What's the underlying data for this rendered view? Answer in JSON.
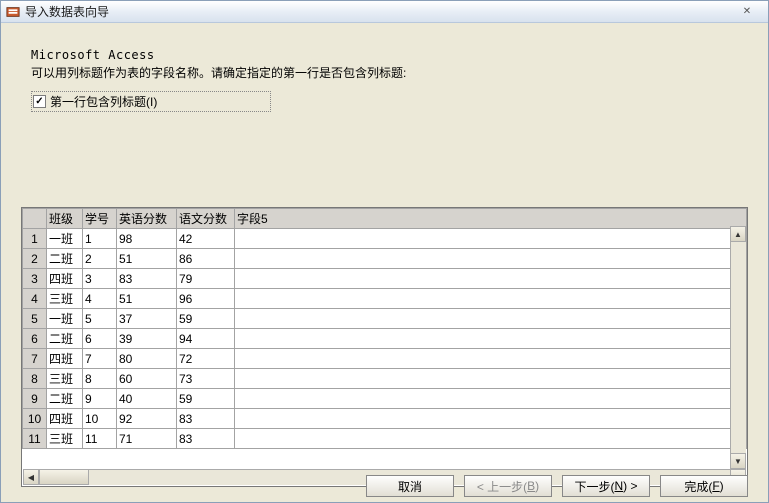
{
  "window": {
    "title": "导入数据表向导",
    "close_glyph": "✕"
  },
  "intro": {
    "app_name": "Microsoft Access",
    "instruction": "可以用列标题作为表的字段名称。请确定指定的第一行是否包含列标题:"
  },
  "checkbox": {
    "label": "第一行包含列标题(I)",
    "checked_glyph": "✓"
  },
  "grid": {
    "headers": [
      "班级",
      "学号",
      "英语分数",
      "语文分数",
      "字段5"
    ],
    "rows": [
      {
        "n": "1",
        "class": "一班",
        "sid": "1",
        "eng": "98",
        "chi": "42"
      },
      {
        "n": "2",
        "class": "二班",
        "sid": "2",
        "eng": "51",
        "chi": "86"
      },
      {
        "n": "3",
        "class": "四班",
        "sid": "3",
        "eng": "83",
        "chi": "79"
      },
      {
        "n": "4",
        "class": "三班",
        "sid": "4",
        "eng": "51",
        "chi": "96"
      },
      {
        "n": "5",
        "class": "一班",
        "sid": "5",
        "eng": "37",
        "chi": "59"
      },
      {
        "n": "6",
        "class": "二班",
        "sid": "6",
        "eng": "39",
        "chi": "94"
      },
      {
        "n": "7",
        "class": "四班",
        "sid": "7",
        "eng": "80",
        "chi": "72"
      },
      {
        "n": "8",
        "class": "三班",
        "sid": "8",
        "eng": "60",
        "chi": "73"
      },
      {
        "n": "9",
        "class": "二班",
        "sid": "9",
        "eng": "40",
        "chi": "59"
      },
      {
        "n": "10",
        "class": "四班",
        "sid": "10",
        "eng": "92",
        "chi": "83"
      },
      {
        "n": "11",
        "class": "三班",
        "sid": "11",
        "eng": "71",
        "chi": "83"
      }
    ]
  },
  "buttons": {
    "cancel": "取消",
    "back_prefix": "< 上一步(",
    "back_key": "B",
    "back_suffix": ")",
    "next_prefix": "下一步(",
    "next_key": "N",
    "next_suffix": ") >",
    "finish_prefix": "完成(",
    "finish_key": "F",
    "finish_suffix": ")"
  },
  "scroll": {
    "up": "▲",
    "down": "▼",
    "left": "◀",
    "right": "▶"
  }
}
